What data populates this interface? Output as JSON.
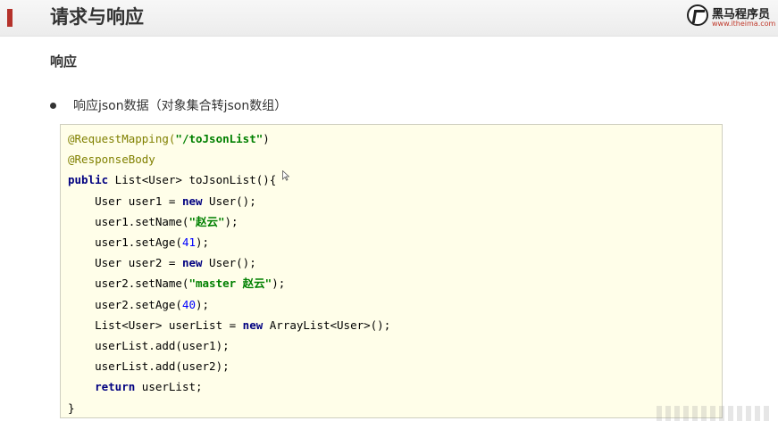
{
  "header": {
    "title": "请求与响应",
    "accent_color": "#b5322b",
    "logo_name": "黑马程序员",
    "logo_url": "www.itheima.com"
  },
  "section": {
    "title": "响应"
  },
  "bullet": {
    "text": "响应json数据（对象集合转json数组）"
  },
  "code": {
    "lines": [
      [
        {
          "t": "@RequestMapping(",
          "c": "annot"
        },
        {
          "t": "\"/toJsonList\"",
          "c": "str"
        },
        {
          "t": ")",
          "c": ""
        }
      ],
      [
        {
          "t": "@ResponseBody",
          "c": "annot"
        }
      ],
      [
        {
          "t": "public",
          "c": "kw"
        },
        {
          "t": " List<User> toJsonList(){",
          "c": ""
        }
      ],
      [
        {
          "t": "    User user1 = ",
          "c": ""
        },
        {
          "t": "new",
          "c": "kw"
        },
        {
          "t": " User();",
          "c": ""
        }
      ],
      [
        {
          "t": "    user1.setName(",
          "c": ""
        },
        {
          "t": "\"赵云\"",
          "c": "str"
        },
        {
          "t": ");",
          "c": ""
        }
      ],
      [
        {
          "t": "    user1.setAge(",
          "c": ""
        },
        {
          "t": "41",
          "c": "num"
        },
        {
          "t": ");",
          "c": ""
        }
      ],
      [
        {
          "t": "    User user2 = ",
          "c": ""
        },
        {
          "t": "new",
          "c": "kw"
        },
        {
          "t": " User();",
          "c": ""
        }
      ],
      [
        {
          "t": "    user2.setName(",
          "c": ""
        },
        {
          "t": "\"master 赵云\"",
          "c": "str"
        },
        {
          "t": ");",
          "c": ""
        }
      ],
      [
        {
          "t": "    user2.setAge(",
          "c": ""
        },
        {
          "t": "40",
          "c": "num"
        },
        {
          "t": ");",
          "c": ""
        }
      ],
      [
        {
          "t": "    List<User> userList = ",
          "c": ""
        },
        {
          "t": "new",
          "c": "kw"
        },
        {
          "t": " ArrayList<User>();",
          "c": ""
        }
      ],
      [
        {
          "t": "    userList.add(user1);",
          "c": ""
        }
      ],
      [
        {
          "t": "    userList.add(user2);",
          "c": ""
        }
      ],
      [
        {
          "t": "    ",
          "c": ""
        },
        {
          "t": "return",
          "c": "kw"
        },
        {
          "t": " userList;",
          "c": ""
        }
      ],
      [
        {
          "t": "}",
          "c": ""
        }
      ]
    ]
  },
  "icons": {
    "logo": "horse-logo-icon",
    "cursor": "mouse-cursor-icon"
  }
}
